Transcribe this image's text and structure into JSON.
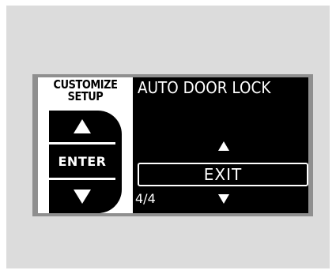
{
  "menu": {
    "title_line1": "CUSTOMIZE",
    "title_line2": "SETUP",
    "enter_label": "ENTER",
    "icons": [
      "up-arrow-icon",
      "down-arrow-icon"
    ]
  },
  "function": {
    "title": "AUTO DOOR LOCK",
    "option_label": "EXIT",
    "page_indicator": "4/4",
    "current_page": 4,
    "total_pages": 4,
    "icons": [
      "scroll-up-icon",
      "scroll-down-icon"
    ]
  },
  "colors": {
    "panel": "#dcdcdc",
    "bezel": "#8f8f8f",
    "screen": "#000000",
    "text": "#ffffff"
  }
}
